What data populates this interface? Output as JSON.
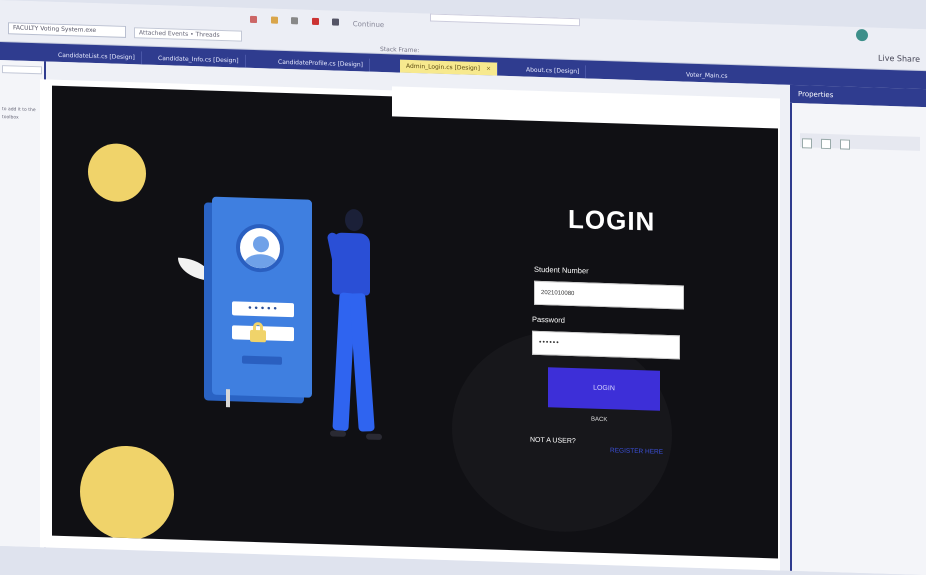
{
  "toolbar": {
    "file_combo": "FACULTY Voting System.exe",
    "file_combo2": "Attached Events • Threads",
    "continue_label": "Continue",
    "start_frame": "Stack Frame:",
    "live_share": "Live Share"
  },
  "tabs": [
    {
      "label": "CandidateList.cs [Design]"
    },
    {
      "label": "Candidate_Info.cs [Design]"
    },
    {
      "label": "CandidateProfile.cs [Design]"
    },
    {
      "label": "Admin_Login.cs [Design]",
      "active": true
    },
    {
      "label": "About.cs [Design]"
    }
  ],
  "tab_right": "Voter_Main.cs",
  "properties": {
    "title": "Properties"
  },
  "sidebar": {
    "text": "to add it to the toolbox"
  },
  "form": {
    "title": "LOGIN",
    "student_label": "Student Number",
    "student_value": "2021010080",
    "password_label": "Password",
    "password_value": "••••••",
    "login_button": "LOGIN",
    "back_label": "BACK",
    "not_user": "NOT A USER?",
    "register": "REGISTER HERE"
  },
  "illustration": {
    "password_dots": "•••••"
  },
  "colors": {
    "accent": "#2f3c8f",
    "active_tab": "#f7e98e",
    "form_bg": "#101014",
    "login_button": "#3d2fd8",
    "yellow": "#f0d36a"
  }
}
